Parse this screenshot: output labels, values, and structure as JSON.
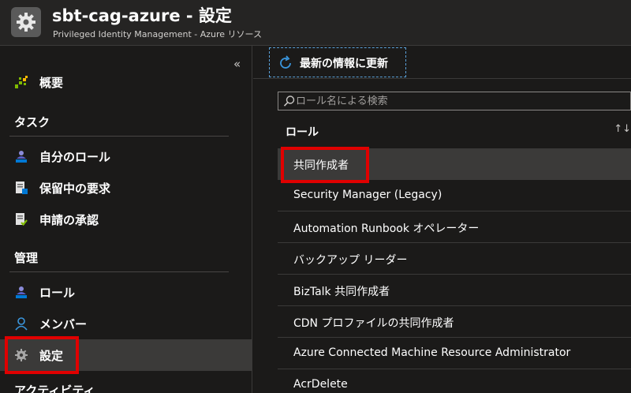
{
  "header": {
    "title": "sbt-cag-azure - 設定",
    "subtitle": "Privileged Identity Management - Azure リソース",
    "icon": "gear-icon"
  },
  "sidebar": {
    "collapse_glyph": "«",
    "overview": {
      "label": "概要",
      "icon": "grid-icon"
    },
    "sections": {
      "tasks": "タスク",
      "manage": "管理",
      "activity": "アクティビティ"
    },
    "tasks": [
      {
        "label": "自分のロール",
        "icon": "user-role-icon"
      },
      {
        "label": "保留中の要求",
        "icon": "pending-request-icon"
      },
      {
        "label": "申請の承認",
        "icon": "approval-icon"
      }
    ],
    "manage": [
      {
        "label": "ロール",
        "icon": "role-icon"
      },
      {
        "label": "メンバー",
        "icon": "member-icon"
      },
      {
        "label": "設定",
        "icon": "settings-gear-icon",
        "active": true
      }
    ]
  },
  "toolbar": {
    "refresh_label": "最新の情報に更新",
    "refresh_icon": "refresh-icon"
  },
  "search": {
    "placeholder": "ロール名による検索",
    "value": ""
  },
  "roles_table": {
    "column_header": "ロール",
    "sort_glyph": "↑↓",
    "rows": [
      "共同作成者",
      "Security Manager (Legacy)",
      "Automation Runbook オペレーター",
      "バックアップ リーダー",
      "BizTalk 共同作成者",
      "CDN プロファイルの共同作成者",
      "Azure Connected Machine Resource Administrator",
      "AcrDelete"
    ]
  },
  "colors": {
    "background": "#1b1a19",
    "highlight_red": "#e00000",
    "accent_blue": "#5aa0d8"
  }
}
